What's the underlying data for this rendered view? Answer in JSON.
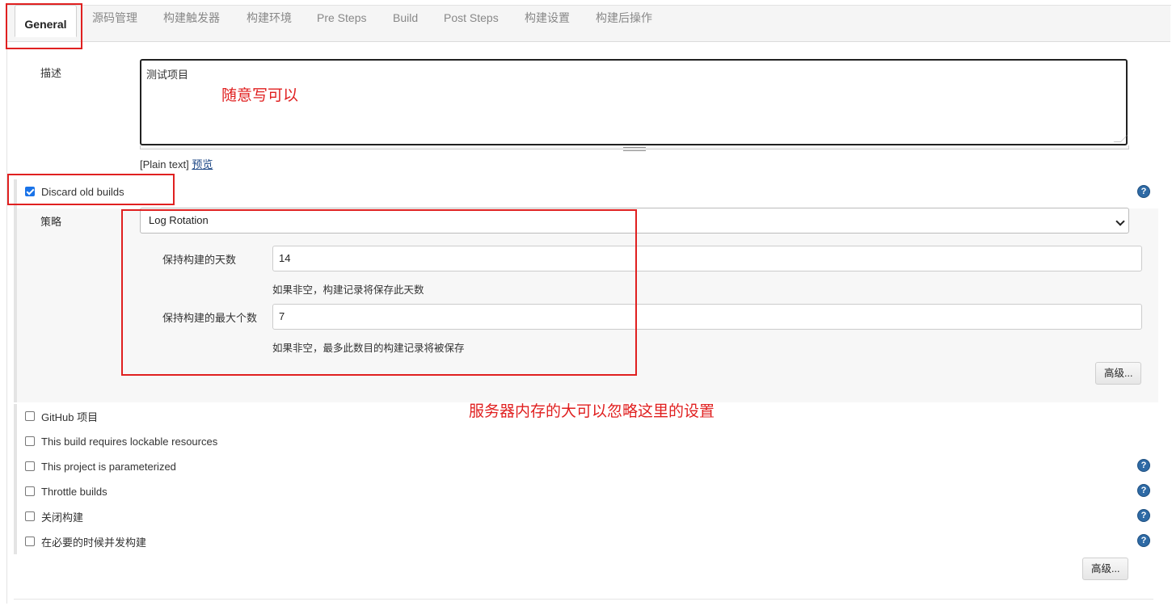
{
  "tabs": [
    {
      "label": "General",
      "active": true
    },
    {
      "label": "源码管理"
    },
    {
      "label": "构建触发器"
    },
    {
      "label": "构建环境"
    },
    {
      "label": "Pre Steps"
    },
    {
      "label": "Build"
    },
    {
      "label": "Post Steps"
    },
    {
      "label": "构建设置"
    },
    {
      "label": "构建后操作"
    }
  ],
  "description": {
    "label": "描述",
    "value": "测试项目",
    "format_note": "[Plain text]",
    "preview_link": "预览"
  },
  "discard_old_builds": {
    "label": "Discard old builds",
    "checked": true,
    "strategy_label": "策略",
    "strategy_value": "Log Rotation",
    "days_label": "保持构建的天数",
    "days_value": "14",
    "days_hint": "如果非空，构建记录将保存此天数",
    "max_label": "保持构建的最大个数",
    "max_value": "7",
    "max_hint": "如果非空，最多此数目的构建记录将被保存",
    "advanced_button": "高级..."
  },
  "options": [
    {
      "label": "GitHub 项目",
      "checked": false
    },
    {
      "label": "This build requires lockable resources",
      "checked": false
    },
    {
      "label": "This project is parameterized",
      "checked": false
    },
    {
      "label": "Throttle builds",
      "checked": false
    },
    {
      "label": "关闭构建",
      "checked": false
    },
    {
      "label": "在必要的时候并发构建",
      "checked": false
    }
  ],
  "help_icon_text": "?",
  "bottom_advanced_button": "高级...",
  "annotations": {
    "description_note": "随意写可以",
    "discard_note": "服务器内存的大可以忽略这里的设置",
    "color": "#e02020"
  }
}
